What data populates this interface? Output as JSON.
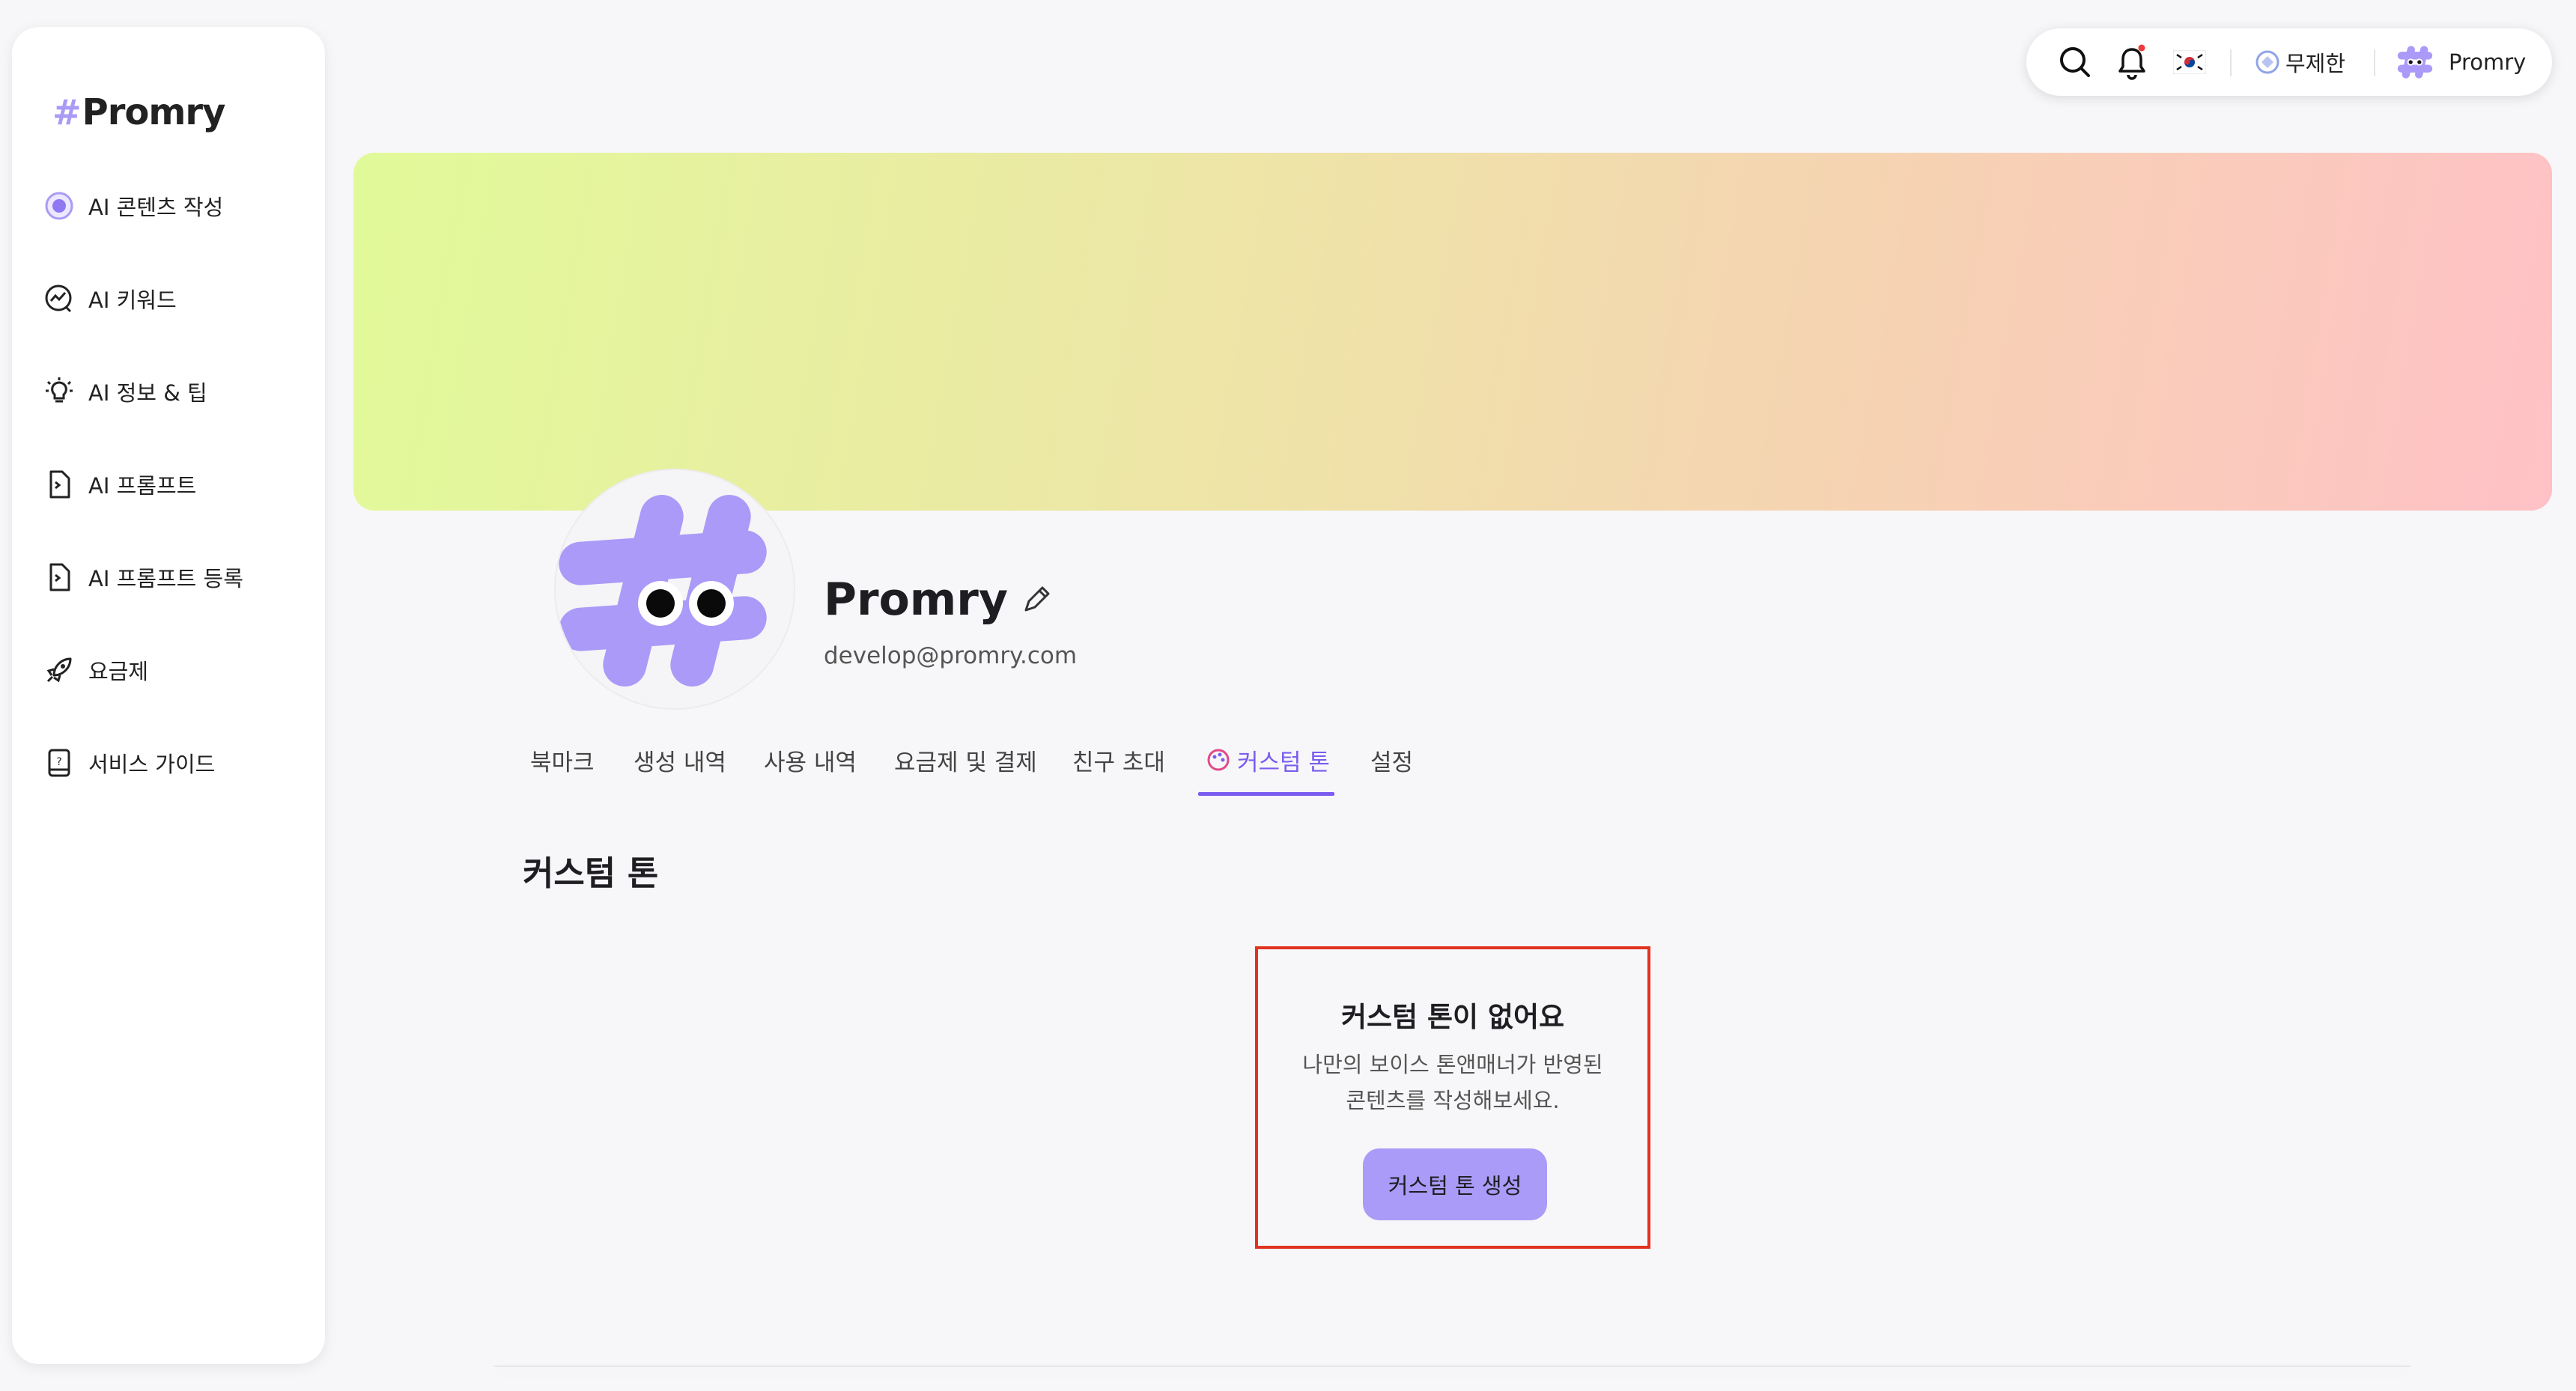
{
  "brand": {
    "logo_text": "Promry",
    "accent": "#a99bf5",
    "active_color": "#7b5cf0"
  },
  "sidebar": {
    "items": [
      {
        "label": "AI 콘텐츠 작성",
        "icon": "ai-sparkle-icon"
      },
      {
        "label": "AI 키워드",
        "icon": "trend-chart-icon"
      },
      {
        "label": "AI 정보 & 팁",
        "icon": "lightbulb-icon"
      },
      {
        "label": "AI 프롬프트",
        "icon": "prompt-doc-icon"
      },
      {
        "label": "AI 프롬프트 등록",
        "icon": "prompt-register-icon"
      },
      {
        "label": "요금제",
        "icon": "rocket-icon"
      },
      {
        "label": "서비스 가이드",
        "icon": "guide-book-icon"
      }
    ]
  },
  "topbar": {
    "search_icon": "search-icon",
    "bell_icon": "bell-icon",
    "language_icon": "korean-flag-icon",
    "plan_label": "무제한",
    "user_name": "Promry"
  },
  "profile": {
    "name": "Promry",
    "email": "develop@promry.com",
    "edit_icon": "pencil-icon"
  },
  "tabs": [
    {
      "label": "북마크"
    },
    {
      "label": "생성 내역"
    },
    {
      "label": "사용 내역"
    },
    {
      "label": "요금제 및 결제"
    },
    {
      "label": "친구 초대"
    },
    {
      "label": "커스텀 톤",
      "active": true
    },
    {
      "label": "설정"
    }
  ],
  "main": {
    "section_title": "커스텀 톤",
    "empty_title": "커스텀 톤이 없어요",
    "empty_desc_line1": "나만의 보이스 톤앤매너가 반영된",
    "empty_desc_line2": "콘텐츠를 작성해보세요.",
    "create_button": "커스텀 톤 생성"
  }
}
